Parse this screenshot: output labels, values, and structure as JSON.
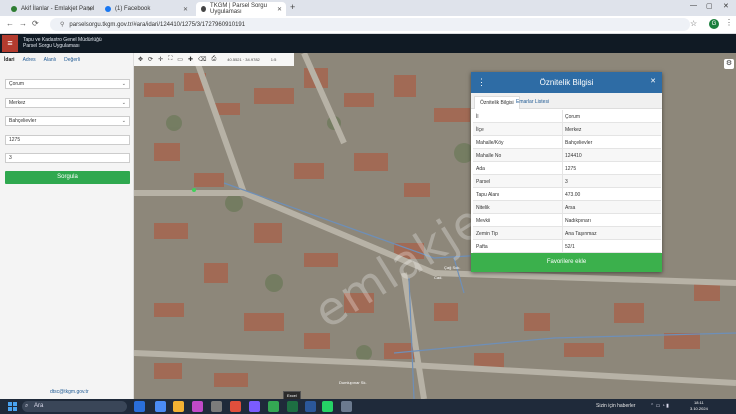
{
  "browser": {
    "tabs": [
      {
        "label": "Akif İlanlar - Emlakjet Panel",
        "color": "#2e7d32"
      },
      {
        "label": "(1) Facebook",
        "color": "#1877f2"
      },
      {
        "label": "TKGM | Parsel Sorgu Uygulaması",
        "color": "#444444"
      }
    ],
    "url": "parselsorgu.tkgm.gov.tr/#ara/idari/124410/1275/3/1727960910191",
    "profile_initial": "G"
  },
  "app": {
    "title_line1": "Tapu ve Kadastro Genel Müdürlüğü",
    "title_line2": "Parsel Sorgu Uygulaması",
    "accent": "#b43b2e"
  },
  "left_panel": {
    "tabs": [
      "İdari",
      "Adres",
      "Alanlı",
      "Değerli"
    ],
    "fields": [
      "Çorum",
      "Merkez",
      "Bahçelievler",
      "1275",
      "3"
    ],
    "submit": "Sorgula",
    "email": "dtsc@tkgm.gov.tr"
  },
  "map": {
    "tools": [
      "✥",
      "⟳",
      "✛",
      "⛶",
      "▭",
      "✚",
      "⌫",
      "⎙"
    ],
    "coords": "40.5521 · 34.9782",
    "scale": "1:5",
    "watermark": "emlakjet.com",
    "street_labels": [
      "Cad.",
      "Çağ Sok.",
      "Dumlupınar Sk."
    ]
  },
  "dialog": {
    "title": "Öznitelik Bilgisi",
    "tabs": [
      "Öznitelik Bilgisi",
      "Emarlar Listesi"
    ],
    "rows": [
      {
        "k": "İl",
        "v": "Çorum"
      },
      {
        "k": "İlçe",
        "v": "Merkez"
      },
      {
        "k": "Mahalle/Köy",
        "v": "Bahçelievler"
      },
      {
        "k": "Mahalle No",
        "v": "124410"
      },
      {
        "k": "Ada",
        "v": "1275"
      },
      {
        "k": "Parsel",
        "v": "3"
      },
      {
        "k": "Tapu Alanı",
        "v": "473.00"
      },
      {
        "k": "Nitelik",
        "v": "Arsa"
      },
      {
        "k": "Mevkii",
        "v": "Nadıkpınarı"
      },
      {
        "k": "Zemin Tip",
        "v": "Ana Taşınmaz"
      },
      {
        "k": "Pafta",
        "v": "52/1"
      }
    ],
    "favorite_button": "Favorilere ekle"
  },
  "taskbar": {
    "search_placeholder": "Ara",
    "tooltip": "Excel",
    "news": "Sizin için haberler",
    "time": "18:11",
    "date": "3.10.2024"
  }
}
